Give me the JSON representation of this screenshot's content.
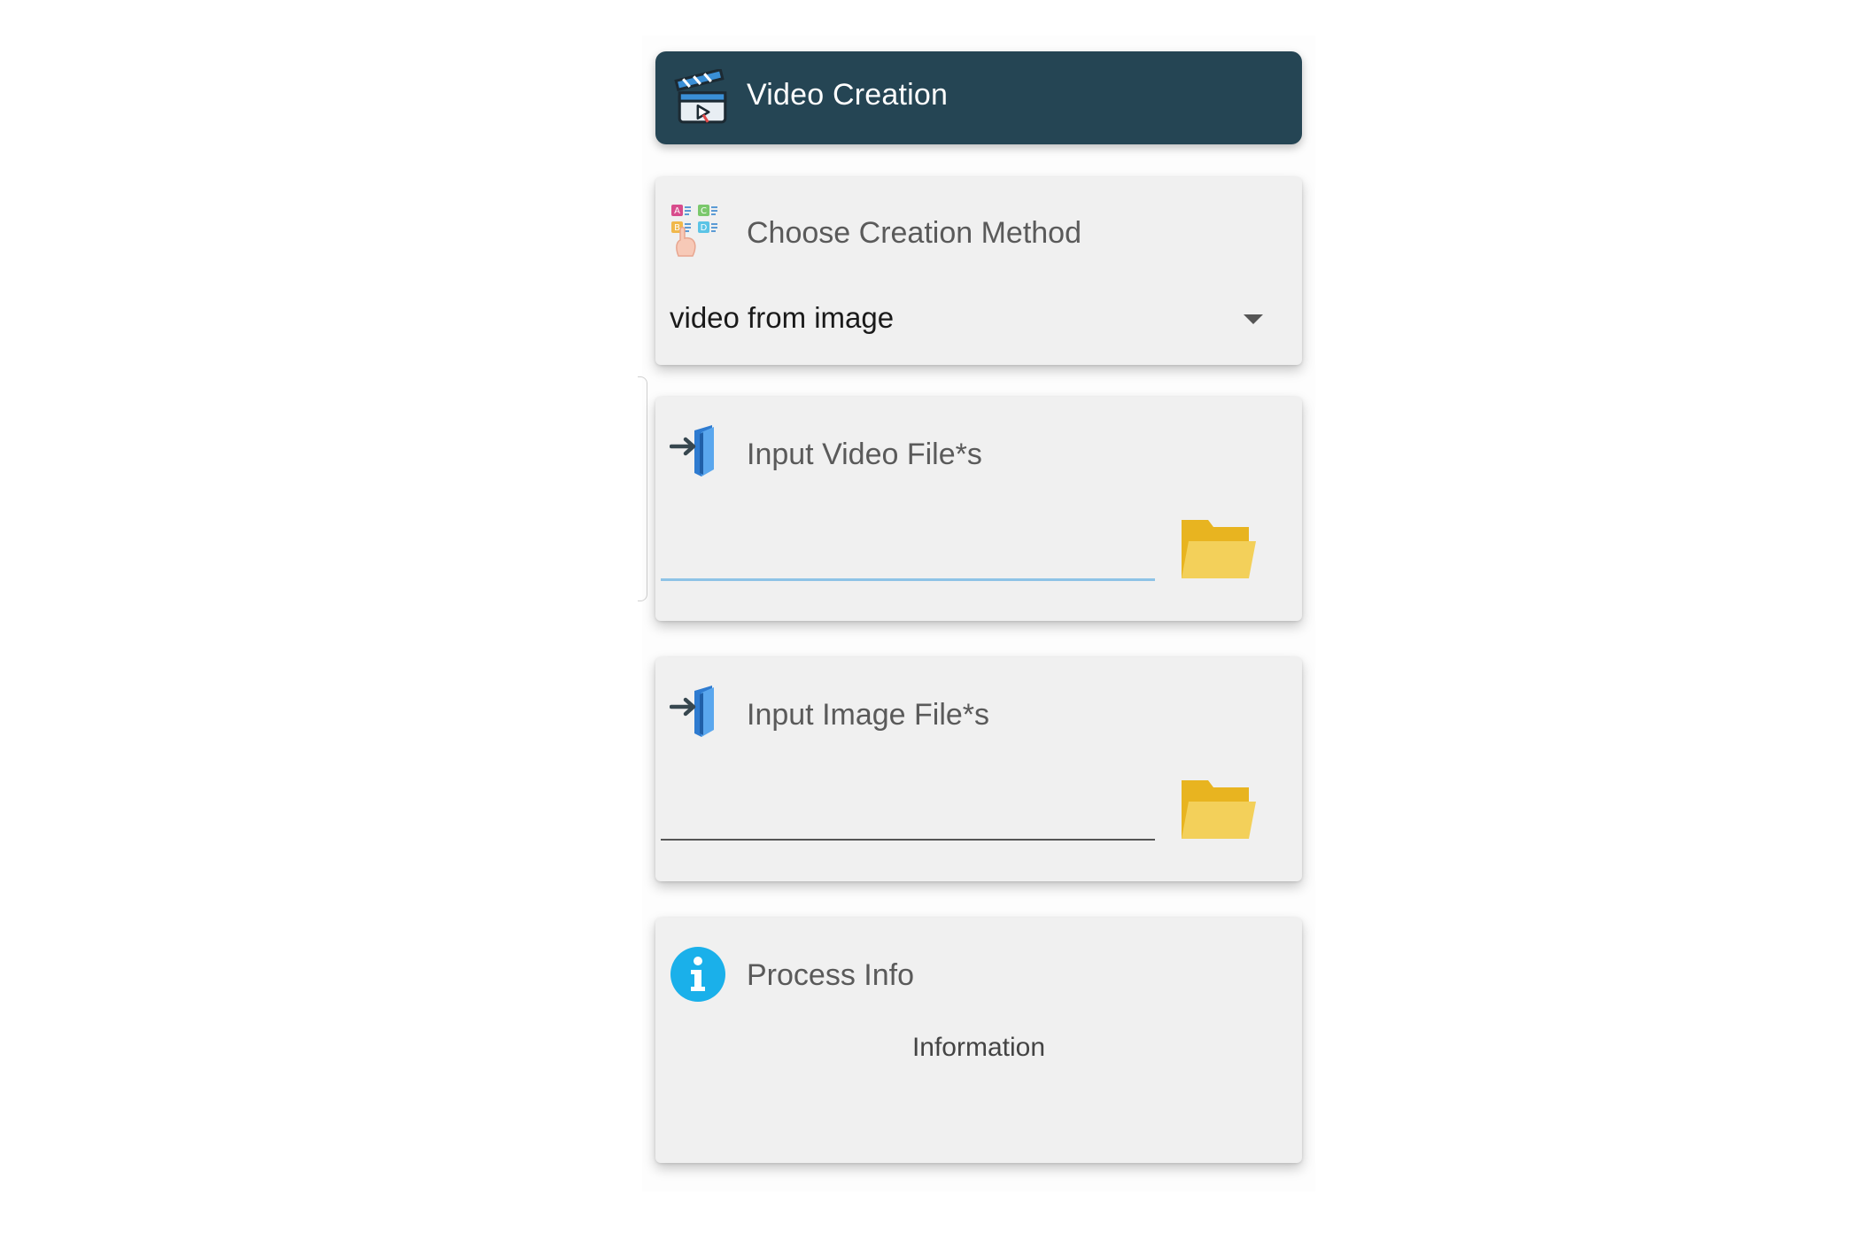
{
  "header": {
    "title": "Video Creation",
    "icon": "clapperboard-icon"
  },
  "method": {
    "title": "Choose Creation Method",
    "icon": "choice-grid-icon",
    "selected": "video from image"
  },
  "video_input": {
    "title": "Input Video File*s",
    "icon": "import-file-icon",
    "value": "",
    "browse_icon": "folder-icon"
  },
  "image_input": {
    "title": "Input Image File*s",
    "icon": "import-file-icon",
    "value": "",
    "browse_icon": "folder-icon"
  },
  "process_info": {
    "title": "Process Info",
    "icon": "info-icon",
    "text": "Information"
  },
  "colors": {
    "header_bg": "#254554",
    "card_bg": "#f0f0f0",
    "focused_underline": "#8ec3e6",
    "folder": "#f2c94c",
    "info": "#1ab0ea"
  }
}
